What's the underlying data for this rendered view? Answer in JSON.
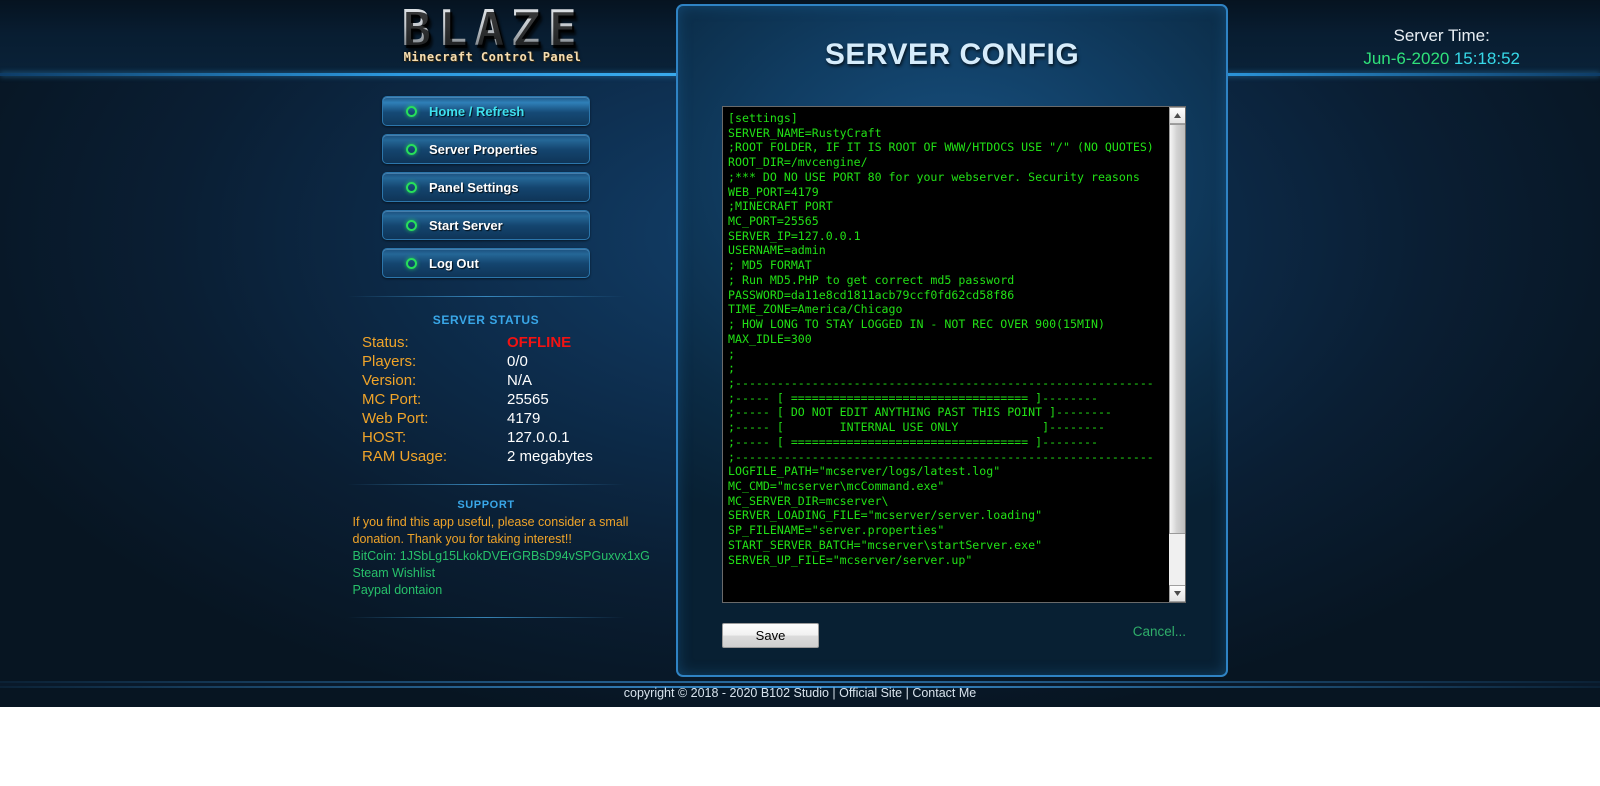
{
  "brand": {
    "logo_text": "BLAZE",
    "logo_subtitle": "Minecraft Control Panel"
  },
  "server_time": {
    "label": "Server Time:",
    "date": "Jun-6-2020",
    "time": "15:18:52"
  },
  "sidebar": {
    "menu": [
      {
        "label": "Home / Refresh",
        "active": true
      },
      {
        "label": "Server Properties",
        "active": false
      },
      {
        "label": "Panel Settings",
        "active": false
      },
      {
        "label": "Start Server",
        "active": false
      },
      {
        "label": "Log Out",
        "active": false
      }
    ],
    "status": {
      "title": "SERVER STATUS",
      "rows": [
        {
          "key": "Status:",
          "value": "OFFLINE",
          "state": "offline"
        },
        {
          "key": "Players:",
          "value": "0/0",
          "state": "normal"
        },
        {
          "key": "Version:",
          "value": "N/A",
          "state": "normal"
        },
        {
          "key": "MC Port:",
          "value": "25565",
          "state": "normal"
        },
        {
          "key": "Web Port:",
          "value": "4179",
          "state": "normal"
        },
        {
          "key": "HOST:",
          "value": "127.0.0.1",
          "state": "normal"
        },
        {
          "key": "RAM Usage:",
          "value": "2 megabytes",
          "state": "normal"
        }
      ]
    },
    "support": {
      "title": "SUPPORT",
      "message": "If you find this app useful, please consider a small donation. Thank you for taking interest!!",
      "bitcoin": "BitCoin: 1JSbLg15LkokDVErGRBsD94vSPGuxvx1xG",
      "steam": "Steam Wishlist",
      "paypal": "Paypal dontaion"
    }
  },
  "main": {
    "title": "SERVER CONFIG",
    "config_text": "[settings]\nSERVER_NAME=RustyCraft\n;ROOT FOLDER, IF IT IS ROOT OF WWW/HTDOCS USE \"/\" (NO QUOTES)\nROOT_DIR=/mvcengine/\n;*** DO NO USE PORT 80 for your webserver. Security reasons\nWEB_PORT=4179\n;MINECRAFT PORT\nMC_PORT=25565\nSERVER_IP=127.0.0.1\nUSERNAME=admin\n; MD5 FORMAT\n; Run MD5.PHP to get correct md5 password\nPASSWORD=da11e8cd1811acb79ccf0fd62cd58f86\nTIME_ZONE=America/Chicago\n; HOW LONG TO STAY LOGGED IN - NOT REC OVER 900(15MIN)\nMAX_IDLE=300\n;\n;\n;------------------------------------------------------------\n;----- [ ================================== ]--------\n;----- [ DO NOT EDIT ANYTHING PAST THIS POINT ]--------\n;----- [        INTERNAL USE ONLY            ]--------\n;----- [ ================================== ]--------\n;------------------------------------------------------------\nLOGFILE_PATH=\"mcserver/logs/latest.log\"\nMC_CMD=\"mcserver\\mcCommand.exe\"\nMC_SERVER_DIR=mcserver\\\nSERVER_LOADING_FILE=\"mcserver/server.loading\"\nSP_FILENAME=\"server.properties\"\nSTART_SERVER_BATCH=\"mcserver\\startServer.exe\"\nSERVER_UP_FILE=\"mcserver/server.up\"",
    "save_label": "Save",
    "cancel_label": "Cancel..."
  },
  "footer": {
    "copyright": "copyright © 2018 - 2020 B102 Studio | ",
    "official_site": "Official Site",
    "separator": " | ",
    "contact": "Contact Me"
  },
  "colors": {
    "accent_blue": "#39a7e8",
    "label_orange": "#f0a429",
    "offline_red": "#f21212",
    "link_green": "#27c06a",
    "terminal_green": "#22e016",
    "time_cyan": "#37d9e8"
  }
}
